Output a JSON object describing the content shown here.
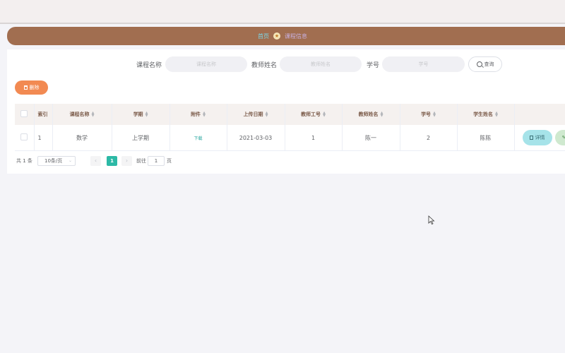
{
  "breadcrumb": {
    "home": "首页",
    "current": "课程信息"
  },
  "search": {
    "fields": [
      {
        "label": "课程名称",
        "placeholder": "课程名称"
      },
      {
        "label": "教师姓名",
        "placeholder": "教师姓名"
      },
      {
        "label": "学号",
        "placeholder": "学号"
      }
    ],
    "button_label": "查询"
  },
  "toolbar": {
    "delete_label": "删除"
  },
  "table": {
    "columns": [
      "索引",
      "课程名称",
      "学期",
      "附件",
      "上传日期",
      "教师工号",
      "教师姓名",
      "学号",
      "学生姓名"
    ],
    "rows": [
      {
        "index": "1",
        "course": "数学",
        "term": "上学期",
        "attachment": "下载",
        "date": "2021-03-03",
        "teacher_id": "1",
        "teacher_name": "陈一",
        "student_id": "2",
        "student_name": "陈陈",
        "detail_label": "详情"
      }
    ]
  },
  "pagination": {
    "total": "共 1 条",
    "page_size": "10条/页",
    "current_page": "1",
    "goto_label": "前往",
    "goto_value": "1",
    "page_unit": "页"
  },
  "colors": {
    "breadcrumb_bg": "#a16e50",
    "delete_button": "#f28a52",
    "active_page": "#2cb9a6",
    "detail_button": "#a6e3e9"
  }
}
